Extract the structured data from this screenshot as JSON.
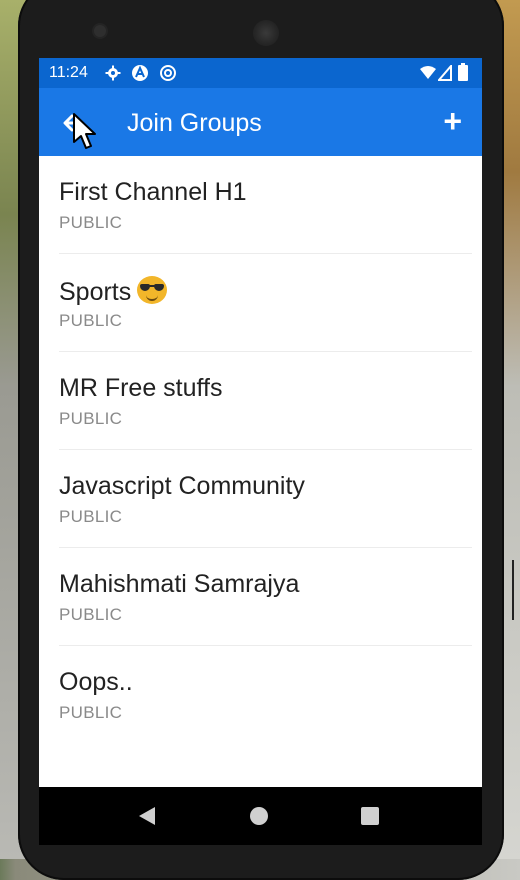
{
  "status_bar": {
    "time": "11:24"
  },
  "app_bar": {
    "title": "Join Groups",
    "add_label": "+"
  },
  "groups": [
    {
      "name": "First Channel H1",
      "type": "PUBLIC"
    },
    {
      "name": "Sports",
      "type": "PUBLIC",
      "emoji": "sunglasses-emoji"
    },
    {
      "name": "MR Free stuffs",
      "type": "PUBLIC"
    },
    {
      "name": "Javascript Community",
      "type": "PUBLIC"
    },
    {
      "name": "Mahishmati Samrajya",
      "type": "PUBLIC"
    },
    {
      "name": "Oops..",
      "type": "PUBLIC"
    }
  ],
  "colors": {
    "status_bar": "#0b66cf",
    "app_bar": "#1a78e6"
  }
}
